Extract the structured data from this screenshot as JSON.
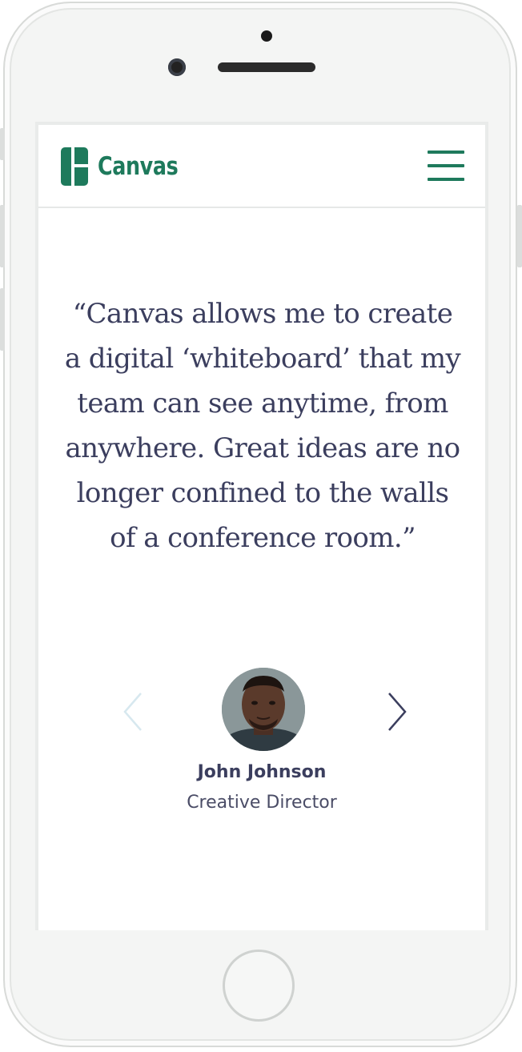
{
  "app": {
    "brand_name": "Canvas",
    "brand_color": "#1e7a5c",
    "logo_icon": "canvas-logo-icon",
    "menu_icon": "hamburger-menu-icon"
  },
  "testimonial": {
    "quote": "“Canvas allows me to create a digital ‘whiteboard’ that my team can see anytime, from anywhere. Great ideas are no longer confined to the walls of a conference room.”",
    "quote_color": "#3b3e5e",
    "person": {
      "name": "John Johnson",
      "role": "Creative Director",
      "avatar_icon": "avatar-photo"
    },
    "prev_icon": "chevron-left-icon",
    "next_icon": "chevron-right-icon"
  },
  "device": {
    "frame_color": "#f4f5f4",
    "home_button_icon": "home-button"
  }
}
